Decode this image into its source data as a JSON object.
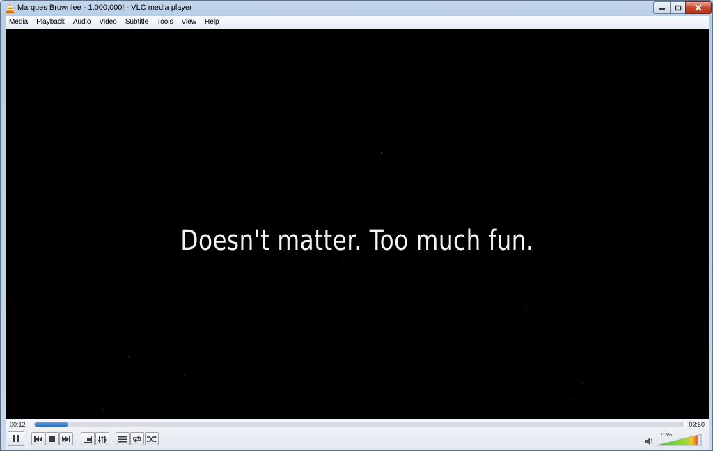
{
  "window": {
    "title": "Marques Brownlee - 1,000,000! - VLC media player"
  },
  "menu": [
    "Media",
    "Playback",
    "Audio",
    "Video",
    "Subtitle",
    "Tools",
    "View",
    "Help"
  ],
  "video": {
    "subtitle": "Doesn't matter. Too much fun."
  },
  "player": {
    "elapsed": "00:12",
    "total": "03:50",
    "progress_fraction": 0.052,
    "volume_label": "115%",
    "volume_fraction": 1.15
  },
  "icons": {
    "app": "vlc-cone-icon",
    "minimize": "minimize-icon",
    "maximize": "maximize-icon",
    "close": "close-icon",
    "pause": "pause-icon",
    "previous": "previous-icon",
    "stop": "stop-icon",
    "next": "next-icon",
    "fullscreen": "fullscreen-icon",
    "extended": "extended-settings-icon",
    "playlist": "playlist-icon",
    "loop": "loop-icon",
    "shuffle": "shuffle-icon",
    "volume": "speaker-icon"
  },
  "colors": {
    "accent": "#2c6fc2",
    "video_bg": "#000000"
  }
}
